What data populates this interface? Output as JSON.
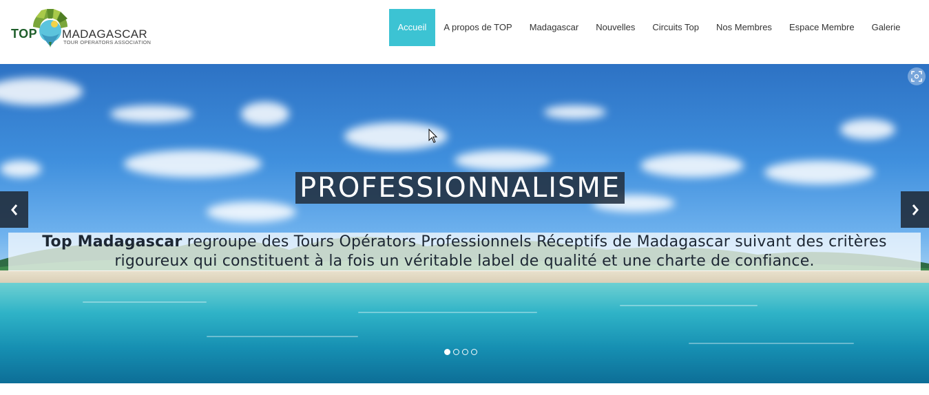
{
  "logo": {
    "top_text": "TOP",
    "main_text": "MADAGASCAR",
    "sub_text": "TOUR OPERATORS ASSOCIATION"
  },
  "nav": {
    "items": [
      {
        "label": "Accueil",
        "active": true
      },
      {
        "label": "A propos de TOP"
      },
      {
        "label": "Madagascar"
      },
      {
        "label": "Nouvelles"
      },
      {
        "label": "Circuits Top"
      },
      {
        "label": "Nos Membres"
      },
      {
        "label": "Espace Membre"
      },
      {
        "label": "Galerie"
      }
    ]
  },
  "hero": {
    "title": "PROFESSIONNALISME",
    "text_bold": "Top Madagascar",
    "text_rest": " regroupe des Tours Opérators Professionnels Réceptifs de Madagascar suivant des critères rigoureux qui constituent à la fois un véritable label de qualité et une charte de confiance.",
    "prev_icon": "chevron-left-icon",
    "next_icon": "chevron-right-icon",
    "slide_count": 4,
    "active_slide": 1
  },
  "colors": {
    "accent": "#3cc3d3",
    "overlay": "#223040"
  }
}
